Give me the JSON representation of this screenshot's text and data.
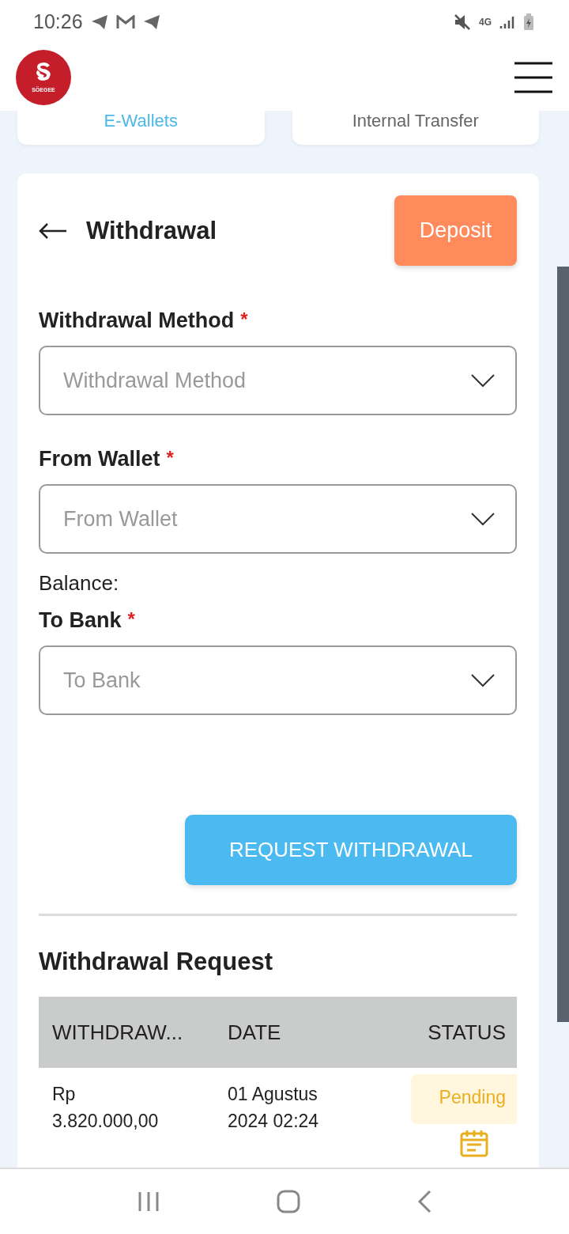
{
  "status_bar": {
    "time": "10:26",
    "network": "4G"
  },
  "header": {
    "logo_text": "SÖEGEE"
  },
  "tabs": [
    {
      "label": "E-Wallets",
      "selected": true
    },
    {
      "label": "Internal Transfer",
      "selected": false
    }
  ],
  "panel": {
    "title": "Withdrawal",
    "action": "Deposit"
  },
  "fields": [
    {
      "label": "Withdrawal Method",
      "mark": "*",
      "placeholder": "Withdrawal Method"
    },
    {
      "label": "From Wallet",
      "mark": "*",
      "placeholder": "From Wallet",
      "note": "Balance:"
    },
    {
      "label": "To Bank",
      "mark": "*",
      "placeholder": "To Bank"
    }
  ],
  "submit": "REQUEST WITHDRAWAL",
  "requests": {
    "title": "Withdrawal Request",
    "columns": [
      "WITHDRAW...",
      "DATE",
      "STATUS"
    ],
    "rows": [
      {
        "amount": "Rp 3.820.000,00",
        "date": "01 Agustus 2024 02:24",
        "status": "Pending"
      }
    ]
  }
}
